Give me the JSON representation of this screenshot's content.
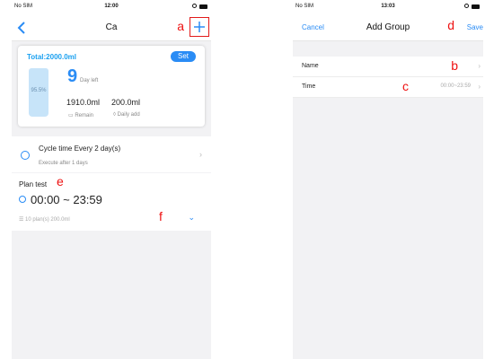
{
  "left": {
    "status": {
      "carrier": "No SIM",
      "time": "12:00"
    },
    "nav": {
      "title": "Ca"
    },
    "callouts": {
      "a": "a",
      "e": "e",
      "f": "f"
    },
    "card": {
      "total": "Total:2000.0ml",
      "set_label": "Set",
      "tank_percent": "95.5%",
      "tank_fill_fraction": 0.955,
      "days_value": "9",
      "days_label": "Day left",
      "remain_value": "1910.0ml",
      "remain_label": "Remain",
      "daily_value": "200.0ml",
      "daily_label": "Daily add"
    },
    "cycle": {
      "title": "Cycle time   Every 2 day(s)",
      "subtitle": "Execute after 1 days"
    },
    "plan": {
      "title": "Plan test",
      "time": "00:00 ~ 23:59",
      "meta": "10 plan(s)   200.0ml"
    }
  },
  "right": {
    "status": {
      "carrier": "No SIM",
      "time": "13:03"
    },
    "nav": {
      "cancel": "Cancel",
      "title": "Add Group",
      "save": "Save"
    },
    "callouts": {
      "b": "b",
      "c": "c",
      "d": "d"
    },
    "rows": [
      {
        "label": "Name",
        "value": ""
      },
      {
        "label": "Time",
        "value": "00:00~23:59"
      }
    ]
  },
  "colors": {
    "accent": "#2a8cf5",
    "callout": "#e11111",
    "tank": "#c7e4f9"
  }
}
